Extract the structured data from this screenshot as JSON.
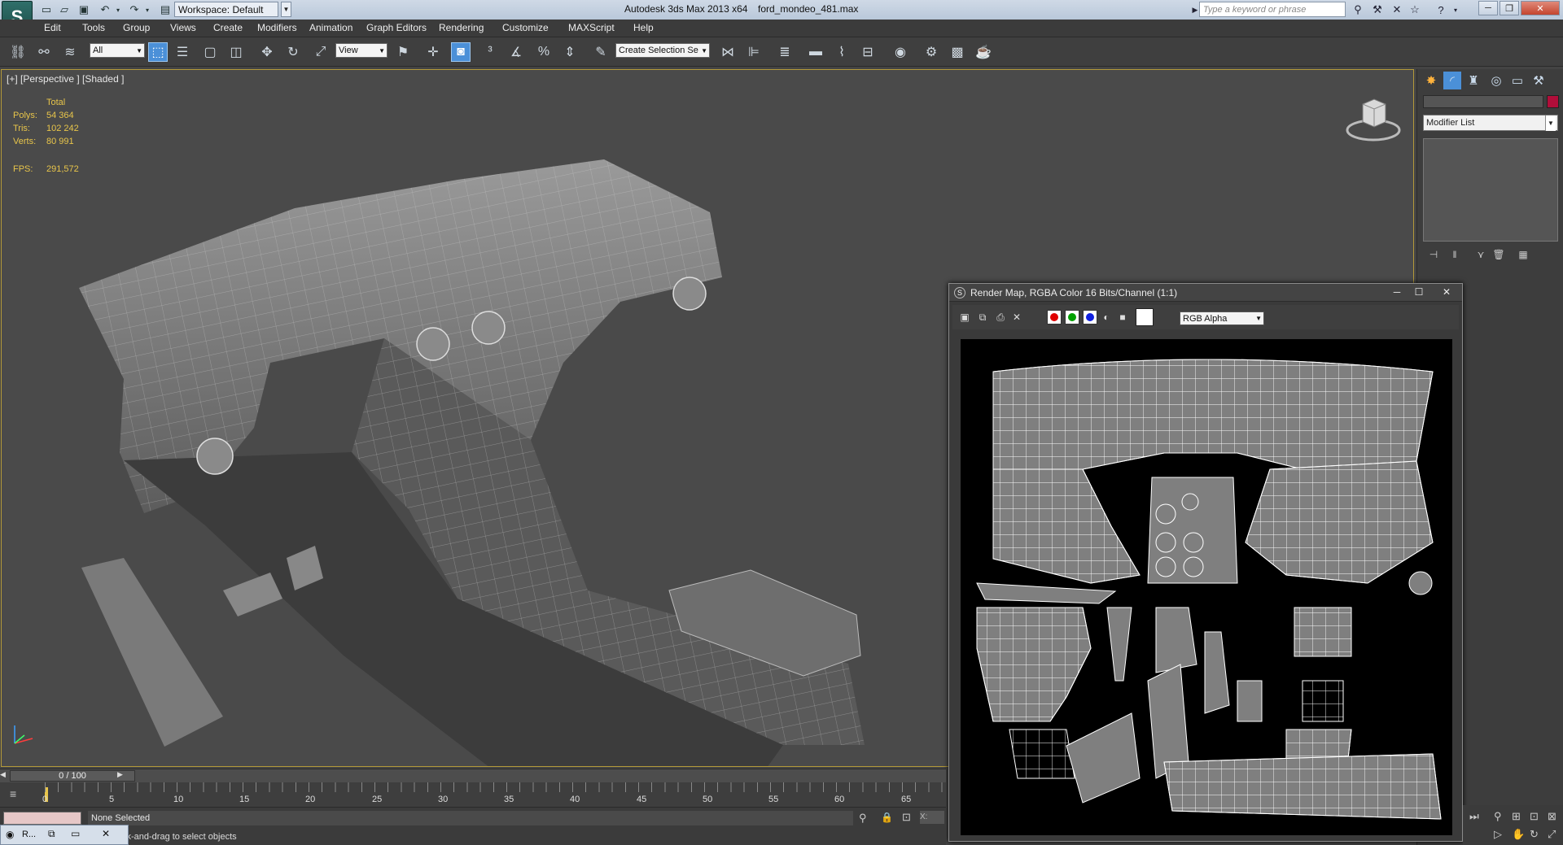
{
  "titlebar": {
    "workspace": "Workspace: Default",
    "app_title": "Autodesk 3ds Max  2013 x64",
    "file_name": "ford_mondeo_481.max",
    "search_placeholder": "Type a keyword or phrase"
  },
  "menu": {
    "items": [
      "Edit",
      "Tools",
      "Group",
      "Views",
      "Create",
      "Modifiers",
      "Animation",
      "Graph Editors",
      "Rendering",
      "Customize",
      "MAXScript",
      "Help"
    ]
  },
  "toolbar": {
    "selection_filter": "All",
    "ref_coord": "View",
    "named_selection": "Create Selection Se"
  },
  "viewport": {
    "label": "[+] [Perspective ] [Shaded ]",
    "stats": {
      "header": "Total",
      "polys_label": "Polys:",
      "polys": "54 364",
      "tris_label": "Tris:",
      "tris": "102 242",
      "verts_label": "Verts:",
      "verts": "80 991",
      "fps_label": "FPS:",
      "fps": "291,572"
    }
  },
  "command_panel": {
    "modifier_list": "Modifier List",
    "object_color": "#b10e3a"
  },
  "render_map": {
    "title": "Render Map, RGBA Color 16 Bits/Channel (1:1)",
    "channel": "RGB Alpha",
    "channels": {
      "red": "#e00000",
      "green": "#00a000",
      "blue": "#1020e0"
    }
  },
  "timeline": {
    "frame": "0 / 100",
    "ticks": [
      "0",
      "5",
      "10",
      "15",
      "20",
      "25",
      "30",
      "35",
      "40",
      "45",
      "50",
      "55",
      "60",
      "65"
    ]
  },
  "status": {
    "selection": "None Selected",
    "prompt": "ck-and-drag to select objects",
    "taskbar_label": "R..."
  }
}
